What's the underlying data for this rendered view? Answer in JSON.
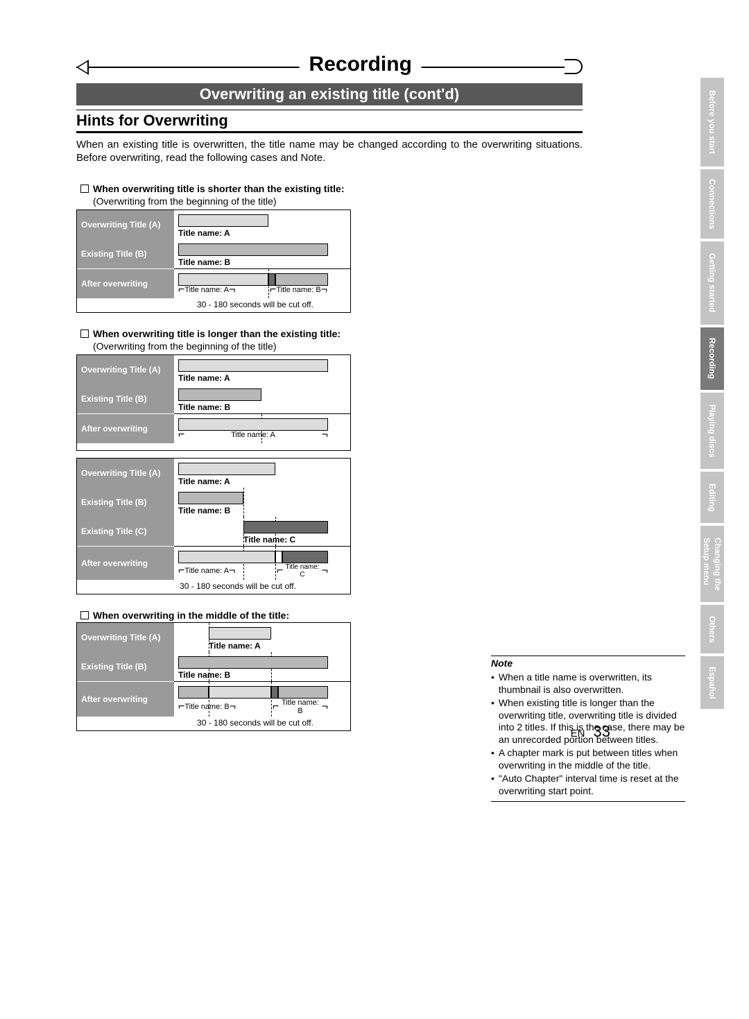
{
  "banner_title": "Recording",
  "sub_banner": "Overwriting an existing title (cont'd)",
  "section_heading": "Hints for Overwriting",
  "intro": "When an existing title is overwritten, the title name may be changed according to the overwriting situations. Before overwriting, read the following cases and Note.",
  "case1": {
    "header": "When overwriting title is shorter than the existing title:",
    "sub": "(Overwriting from the beginning of the title)",
    "rows": {
      "r1": "Overwriting Title (A)",
      "r2": "Existing Title (B)",
      "r3": "After overwriting"
    },
    "labels": {
      "a": "Title name: A",
      "b": "Title name: B",
      "b2": "Title name: B"
    },
    "footnote": "30 - 180 seconds will be cut off."
  },
  "case2": {
    "header": "When overwriting title is longer than the existing title:",
    "sub": "(Overwriting from the beginning of the title)",
    "rows": {
      "r1": "Overwriting Title (A)",
      "r2": "Existing Title (B)",
      "r3": "After overwriting"
    },
    "labels": {
      "a": "Title name: A",
      "b": "Title name: B",
      "a2": "Title name: A"
    }
  },
  "case2b": {
    "rows": {
      "r1": "Overwriting Title (A)",
      "r2": "Existing Title (B)",
      "r3": "Existing Title (C)",
      "r4": "After overwriting"
    },
    "labels": {
      "a": "Title name: A",
      "b": "Title name: B",
      "c": "Title name: C",
      "a2": "Title name: A",
      "c2": "Title name: C"
    },
    "footnote": "30 - 180 seconds will be cut off."
  },
  "case3": {
    "header": "When overwriting in the middle of the title:",
    "rows": {
      "r1": "Overwriting Title (A)",
      "r2": "Existing Title (B)",
      "r3": "After overwriting"
    },
    "labels": {
      "a": "Title name: A",
      "b": "Title name: B",
      "b1": "Title name: B",
      "b2": "Title name: B"
    },
    "footnote": "30 - 180 seconds will be cut off."
  },
  "note": {
    "heading": "Note",
    "items": [
      "When a title name is overwritten, its thumbnail is also overwritten.",
      "When existing title is longer than the overwriting title, overwriting title is divided into 2 titles. If this is the case, there may be an unrecorded portion between titles.",
      "A chapter mark is put between titles when overwriting in the middle of the title.",
      "\"Auto Chapter\" interval time is reset at the overwriting start point."
    ]
  },
  "page_footer": {
    "lang": "EN",
    "num": "33"
  },
  "tabs": [
    {
      "label": "Before you start",
      "active": false
    },
    {
      "label": "Connections",
      "active": false
    },
    {
      "label": "Getting started",
      "active": false
    },
    {
      "label": "Recording",
      "active": true
    },
    {
      "label": "Playing discs",
      "active": false
    },
    {
      "label": "Editing",
      "active": false
    },
    {
      "label": "Changing the\nSetup menu",
      "active": false,
      "twoline": true
    },
    {
      "label": "Others",
      "active": false
    },
    {
      "label": "Español",
      "active": false
    }
  ]
}
